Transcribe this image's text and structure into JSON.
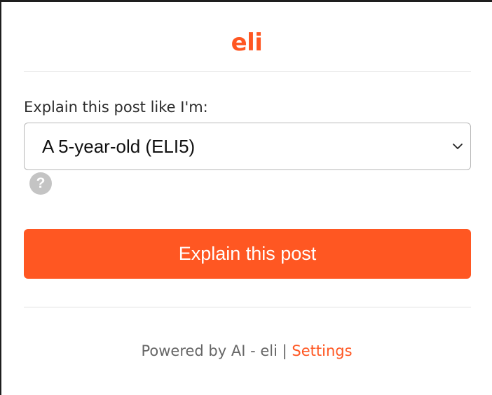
{
  "app": {
    "logo_text": "eli"
  },
  "form": {
    "prompt_label": "Explain this post like I'm:",
    "level_select": {
      "selected": "A 5-year-old (ELI5)"
    },
    "help_glyph": "?",
    "explain_button_label": "Explain this post"
  },
  "footer": {
    "powered_text": "Powered by AI - eli",
    "separator": "|",
    "settings_label": "Settings"
  },
  "colors": {
    "brand": "#ff5722",
    "text": "#2b2b2b",
    "muted": "#666666",
    "help_icon": "#c4c4c4",
    "divider": "#e2e2e2"
  },
  "icons": {
    "dropdown": "chevron-down-icon",
    "help": "question-mark-icon"
  }
}
